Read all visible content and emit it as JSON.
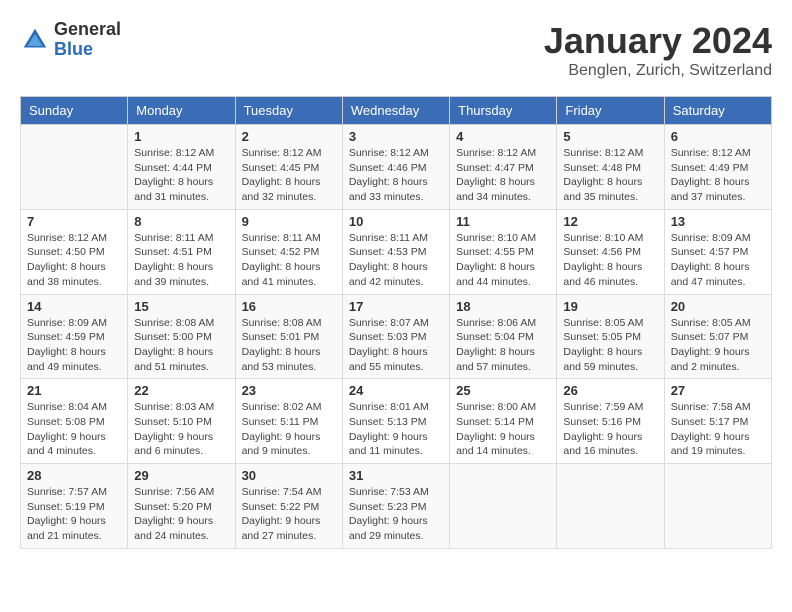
{
  "logo": {
    "general": "General",
    "blue": "Blue"
  },
  "header": {
    "month": "January 2024",
    "location": "Benglen, Zurich, Switzerland"
  },
  "columns": [
    "Sunday",
    "Monday",
    "Tuesday",
    "Wednesday",
    "Thursday",
    "Friday",
    "Saturday"
  ],
  "weeks": [
    [
      {
        "day": "",
        "info": ""
      },
      {
        "day": "1",
        "info": "Sunrise: 8:12 AM\nSunset: 4:44 PM\nDaylight: 8 hours\nand 31 minutes."
      },
      {
        "day": "2",
        "info": "Sunrise: 8:12 AM\nSunset: 4:45 PM\nDaylight: 8 hours\nand 32 minutes."
      },
      {
        "day": "3",
        "info": "Sunrise: 8:12 AM\nSunset: 4:46 PM\nDaylight: 8 hours\nand 33 minutes."
      },
      {
        "day": "4",
        "info": "Sunrise: 8:12 AM\nSunset: 4:47 PM\nDaylight: 8 hours\nand 34 minutes."
      },
      {
        "day": "5",
        "info": "Sunrise: 8:12 AM\nSunset: 4:48 PM\nDaylight: 8 hours\nand 35 minutes."
      },
      {
        "day": "6",
        "info": "Sunrise: 8:12 AM\nSunset: 4:49 PM\nDaylight: 8 hours\nand 37 minutes."
      }
    ],
    [
      {
        "day": "7",
        "info": "Sunrise: 8:12 AM\nSunset: 4:50 PM\nDaylight: 8 hours\nand 38 minutes."
      },
      {
        "day": "8",
        "info": "Sunrise: 8:11 AM\nSunset: 4:51 PM\nDaylight: 8 hours\nand 39 minutes."
      },
      {
        "day": "9",
        "info": "Sunrise: 8:11 AM\nSunset: 4:52 PM\nDaylight: 8 hours\nand 41 minutes."
      },
      {
        "day": "10",
        "info": "Sunrise: 8:11 AM\nSunset: 4:53 PM\nDaylight: 8 hours\nand 42 minutes."
      },
      {
        "day": "11",
        "info": "Sunrise: 8:10 AM\nSunset: 4:55 PM\nDaylight: 8 hours\nand 44 minutes."
      },
      {
        "day": "12",
        "info": "Sunrise: 8:10 AM\nSunset: 4:56 PM\nDaylight: 8 hours\nand 46 minutes."
      },
      {
        "day": "13",
        "info": "Sunrise: 8:09 AM\nSunset: 4:57 PM\nDaylight: 8 hours\nand 47 minutes."
      }
    ],
    [
      {
        "day": "14",
        "info": "Sunrise: 8:09 AM\nSunset: 4:59 PM\nDaylight: 8 hours\nand 49 minutes."
      },
      {
        "day": "15",
        "info": "Sunrise: 8:08 AM\nSunset: 5:00 PM\nDaylight: 8 hours\nand 51 minutes."
      },
      {
        "day": "16",
        "info": "Sunrise: 8:08 AM\nSunset: 5:01 PM\nDaylight: 8 hours\nand 53 minutes."
      },
      {
        "day": "17",
        "info": "Sunrise: 8:07 AM\nSunset: 5:03 PM\nDaylight: 8 hours\nand 55 minutes."
      },
      {
        "day": "18",
        "info": "Sunrise: 8:06 AM\nSunset: 5:04 PM\nDaylight: 8 hours\nand 57 minutes."
      },
      {
        "day": "19",
        "info": "Sunrise: 8:05 AM\nSunset: 5:05 PM\nDaylight: 8 hours\nand 59 minutes."
      },
      {
        "day": "20",
        "info": "Sunrise: 8:05 AM\nSunset: 5:07 PM\nDaylight: 9 hours\nand 2 minutes."
      }
    ],
    [
      {
        "day": "21",
        "info": "Sunrise: 8:04 AM\nSunset: 5:08 PM\nDaylight: 9 hours\nand 4 minutes."
      },
      {
        "day": "22",
        "info": "Sunrise: 8:03 AM\nSunset: 5:10 PM\nDaylight: 9 hours\nand 6 minutes."
      },
      {
        "day": "23",
        "info": "Sunrise: 8:02 AM\nSunset: 5:11 PM\nDaylight: 9 hours\nand 9 minutes."
      },
      {
        "day": "24",
        "info": "Sunrise: 8:01 AM\nSunset: 5:13 PM\nDaylight: 9 hours\nand 11 minutes."
      },
      {
        "day": "25",
        "info": "Sunrise: 8:00 AM\nSunset: 5:14 PM\nDaylight: 9 hours\nand 14 minutes."
      },
      {
        "day": "26",
        "info": "Sunrise: 7:59 AM\nSunset: 5:16 PM\nDaylight: 9 hours\nand 16 minutes."
      },
      {
        "day": "27",
        "info": "Sunrise: 7:58 AM\nSunset: 5:17 PM\nDaylight: 9 hours\nand 19 minutes."
      }
    ],
    [
      {
        "day": "28",
        "info": "Sunrise: 7:57 AM\nSunset: 5:19 PM\nDaylight: 9 hours\nand 21 minutes."
      },
      {
        "day": "29",
        "info": "Sunrise: 7:56 AM\nSunset: 5:20 PM\nDaylight: 9 hours\nand 24 minutes."
      },
      {
        "day": "30",
        "info": "Sunrise: 7:54 AM\nSunset: 5:22 PM\nDaylight: 9 hours\nand 27 minutes."
      },
      {
        "day": "31",
        "info": "Sunrise: 7:53 AM\nSunset: 5:23 PM\nDaylight: 9 hours\nand 29 minutes."
      },
      {
        "day": "",
        "info": ""
      },
      {
        "day": "",
        "info": ""
      },
      {
        "day": "",
        "info": ""
      }
    ]
  ]
}
